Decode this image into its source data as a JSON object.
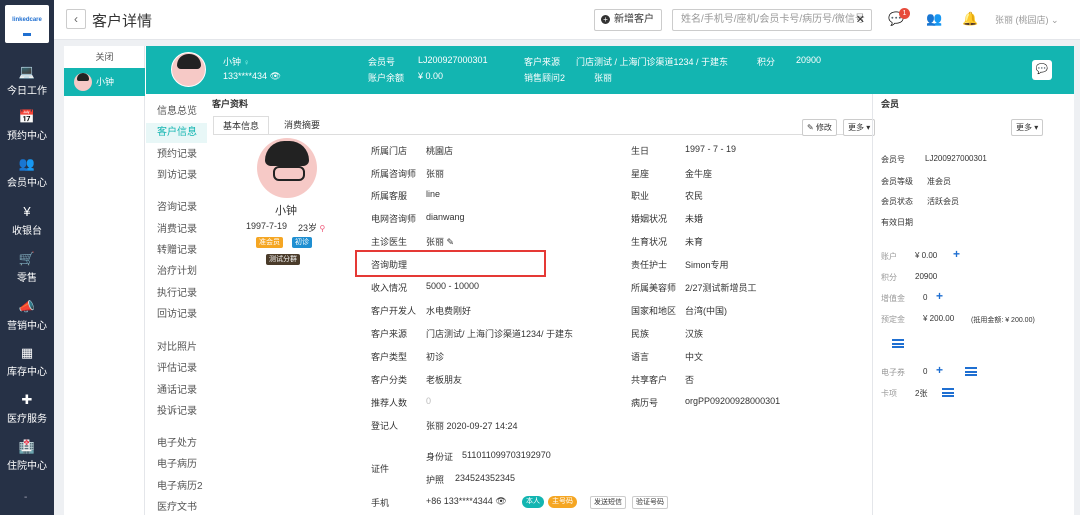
{
  "app": {
    "logo_text": "linkedcare"
  },
  "nav": [
    {
      "icon": "laptop-icon",
      "glyph": "💻",
      "label": "今日工作"
    },
    {
      "icon": "calendar-icon",
      "glyph": "📅",
      "label": "预约中心"
    },
    {
      "icon": "users-icon",
      "glyph": "👥",
      "label": "会员中心"
    },
    {
      "icon": "yen-icon",
      "glyph": "¥",
      "label": "收银台"
    },
    {
      "icon": "cart-icon",
      "glyph": "🛒",
      "label": "零售"
    },
    {
      "icon": "megaphone-icon",
      "glyph": "📣",
      "label": "营销中心"
    },
    {
      "icon": "grid-icon",
      "glyph": "▦",
      "label": "库存中心"
    },
    {
      "icon": "medkit-icon",
      "glyph": "✚",
      "label": "医疗服务"
    },
    {
      "icon": "hospital-icon",
      "glyph": "🏥",
      "label": "住院中心"
    }
  ],
  "topbar": {
    "back": "‹",
    "title": "客户详情",
    "new_customer": "新增客户",
    "search_placeholder": "姓名/手机号/座机/会员卡号/病历号/微信号",
    "chat_badge": "1",
    "user": "张丽 (桃园店) ⌄"
  },
  "side_tabs": {
    "close": "关闭",
    "customer": "小钟"
  },
  "header": {
    "name": "小钟",
    "phone": "133****434",
    "member_no_label": "会员号",
    "member_no": "LJ200927000301",
    "source_label": "客户来源",
    "source": "门店测试 / 上海门诊渠道1234 / 于建东",
    "points_label": "积分",
    "points": "20900",
    "balance_label": "账户余额",
    "balance": "¥ 0.00",
    "consultant_label": "销售顾问2",
    "consultant": "张丽"
  },
  "menu": [
    {
      "label": "信息总览",
      "active": false
    },
    {
      "label": "客户信息",
      "active": true
    },
    {
      "label": "预约记录",
      "active": false
    },
    {
      "label": "到访记录",
      "active": false
    },
    {
      "label": "咨询记录",
      "active": false
    },
    {
      "label": "消费记录",
      "active": false
    },
    {
      "label": "转赠记录",
      "active": false
    },
    {
      "label": "治疗计划",
      "active": false
    },
    {
      "label": "执行记录",
      "active": false
    },
    {
      "label": "回访记录",
      "active": false
    },
    {
      "label": "对比照片",
      "active": false
    },
    {
      "label": "评估记录",
      "active": false
    },
    {
      "label": "通话记录",
      "active": false
    },
    {
      "label": "投诉记录",
      "active": false
    },
    {
      "label": "电子处方",
      "active": false
    },
    {
      "label": "电子病历",
      "active": false
    },
    {
      "label": "电子病历2",
      "active": false
    },
    {
      "label": "医疗文书",
      "active": false
    }
  ],
  "customer_section": {
    "title": "客户资料",
    "tab_basic": "基本信息",
    "tab_consumption": "消费摘要",
    "edit": "修改",
    "more": "更多 ▾"
  },
  "profile": {
    "name": "小钟",
    "birthday": "1997-7-19",
    "age": "23岁",
    "tag_member": "准会员",
    "tag_first": "初诊",
    "tag_group": "测试分群"
  },
  "fields_left": [
    {
      "label": "所属门店",
      "value": "桃園店"
    },
    {
      "label": "所属咨询师",
      "value": "张丽"
    },
    {
      "label": "所属客服",
      "value": "line"
    },
    {
      "label": "电网咨询师",
      "value": "dianwang"
    },
    {
      "label": "主诊医生",
      "value": "张丽 ✎"
    },
    {
      "label": "咨询助理",
      "value": ""
    },
    {
      "label": "收入情况",
      "value": "5000 - 10000"
    },
    {
      "label": "客户开发人",
      "value": "水电费刚好"
    },
    {
      "label": "客户来源",
      "value": "门店测试/ 上海门诊渠道1234/ 于建东"
    },
    {
      "label": "客户类型",
      "value": "初诊"
    },
    {
      "label": "客户分类",
      "value": "老板朋友"
    },
    {
      "label": "推荐人数",
      "value": "0"
    },
    {
      "label": "登记人",
      "value": "张丽    2020-09-27 14:24"
    }
  ],
  "fields_right": [
    {
      "label": "生日",
      "value": "1997 - 7 - 19"
    },
    {
      "label": "星座",
      "value": "金牛座"
    },
    {
      "label": "职业",
      "value": "农民"
    },
    {
      "label": "婚姻状况",
      "value": "未婚"
    },
    {
      "label": "生育状况",
      "value": "未育"
    },
    {
      "label": "责任护士",
      "value": "Simon专用"
    },
    {
      "label": "所属美容师",
      "value": "2/27测试新增员工"
    },
    {
      "label": "国家和地区",
      "value": "台湾(中国)"
    },
    {
      "label": "民族",
      "value": "汉族"
    },
    {
      "label": "语言",
      "value": "中文"
    },
    {
      "label": "共享客户",
      "value": "否"
    },
    {
      "label": "病历号",
      "value": "orgPP09200928000301"
    }
  ],
  "id_section": {
    "label": "证件",
    "idcard_label": "身份证",
    "idcard": "511011099703192970",
    "passport_label": "护照",
    "passport": "234524352345"
  },
  "phone_row": {
    "label": "手机",
    "value": "+86  133****4344",
    "pill_self": "本人",
    "pill_main": "主号码",
    "send_sms": "发送短信",
    "verify": "验证号码"
  },
  "member_panel": {
    "title": "会员",
    "more": "更多 ▾",
    "member_no_label": "会员号",
    "member_no": "LJ200927000301",
    "level_label": "会员等级",
    "level": "准会员",
    "status_label": "会员状态",
    "status": "活跃会员",
    "valid_label": "有效日期",
    "account_label": "账户",
    "account": "¥ 0.00",
    "points_label": "积分",
    "points": "20900",
    "value_label": "增值金",
    "value": "0",
    "deposit_label": "预定金",
    "deposit": "¥ 200.00",
    "deposit_note": "(抵用金额: ¥ 200.00)",
    "coupon_label": "电子券",
    "coupon": "0",
    "card_label": "卡项",
    "card": "2张"
  }
}
